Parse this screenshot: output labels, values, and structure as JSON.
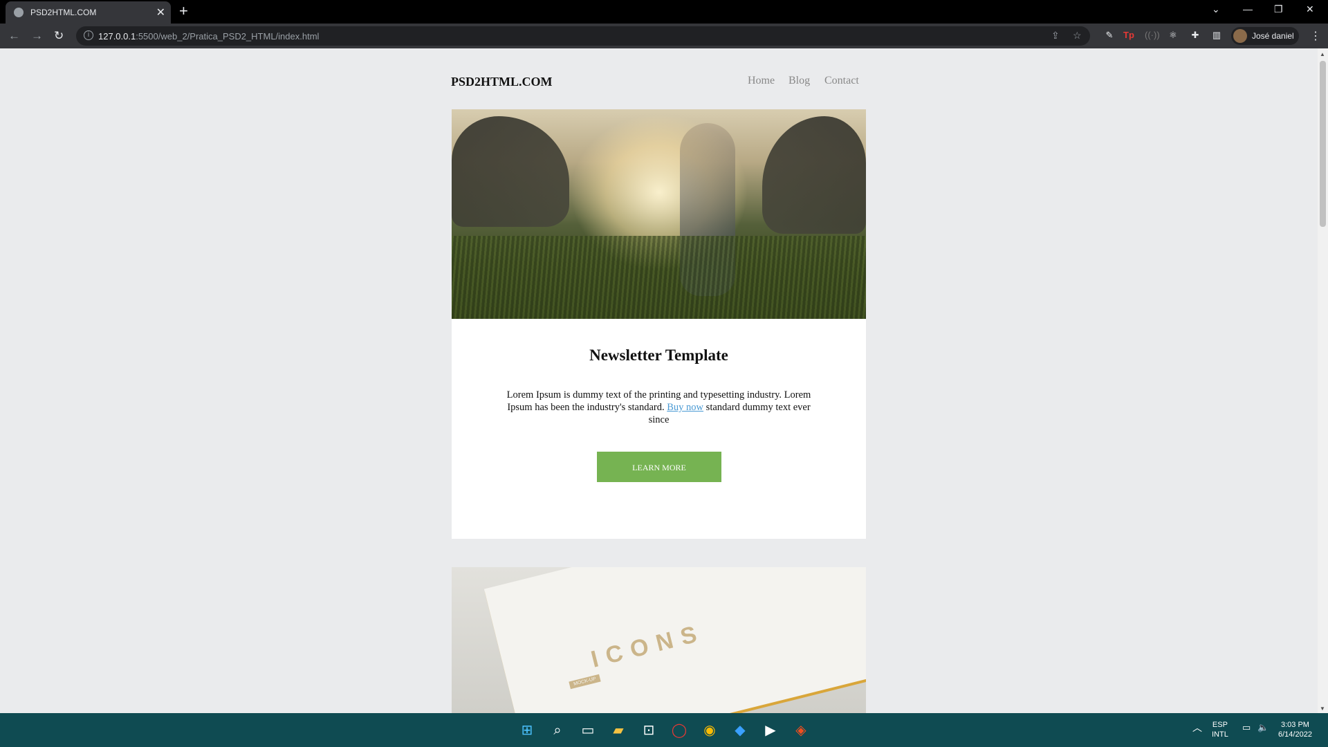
{
  "browser": {
    "tab_title": "PSD2HTML.COM",
    "tab_close": "✕",
    "new_tab": "+",
    "url_host": "127.0.0.1",
    "url_path": ":5500/web_2/Pratica_PSD2_HTML/index.html",
    "profile_name": "José daniel",
    "window_controls": [
      "⌄",
      "—",
      "❐",
      "✕"
    ],
    "nav": {
      "back": "←",
      "forward": "→",
      "reload": "↻",
      "menu": "⋮"
    }
  },
  "site": {
    "logo": "PSD2HTML.COM",
    "nav": [
      "Home",
      "Blog",
      "Contact"
    ]
  },
  "article": {
    "title": "Newsletter Template",
    "text_before_link": "Lorem Ipsum is dummy text of the printing and typesetting industry. Lorem Ipsum has been the industry's standard.",
    "link_text": "Buy now",
    "text_after_link": "standard dummy text ever since",
    "button_label": "LEARN MORE"
  },
  "book_image": {
    "label": "ICONS",
    "mock_label": "MOCK-UP"
  },
  "taskbar": {
    "lang_top": "ESP",
    "lang_bottom": "INTL",
    "time": "3:03 PM",
    "date": "6/14/2022"
  },
  "colors": {
    "accent_button": "#76b352",
    "link": "#4a9ad4",
    "page_bg": "#eaebed",
    "taskbar": "#0f4b52"
  }
}
